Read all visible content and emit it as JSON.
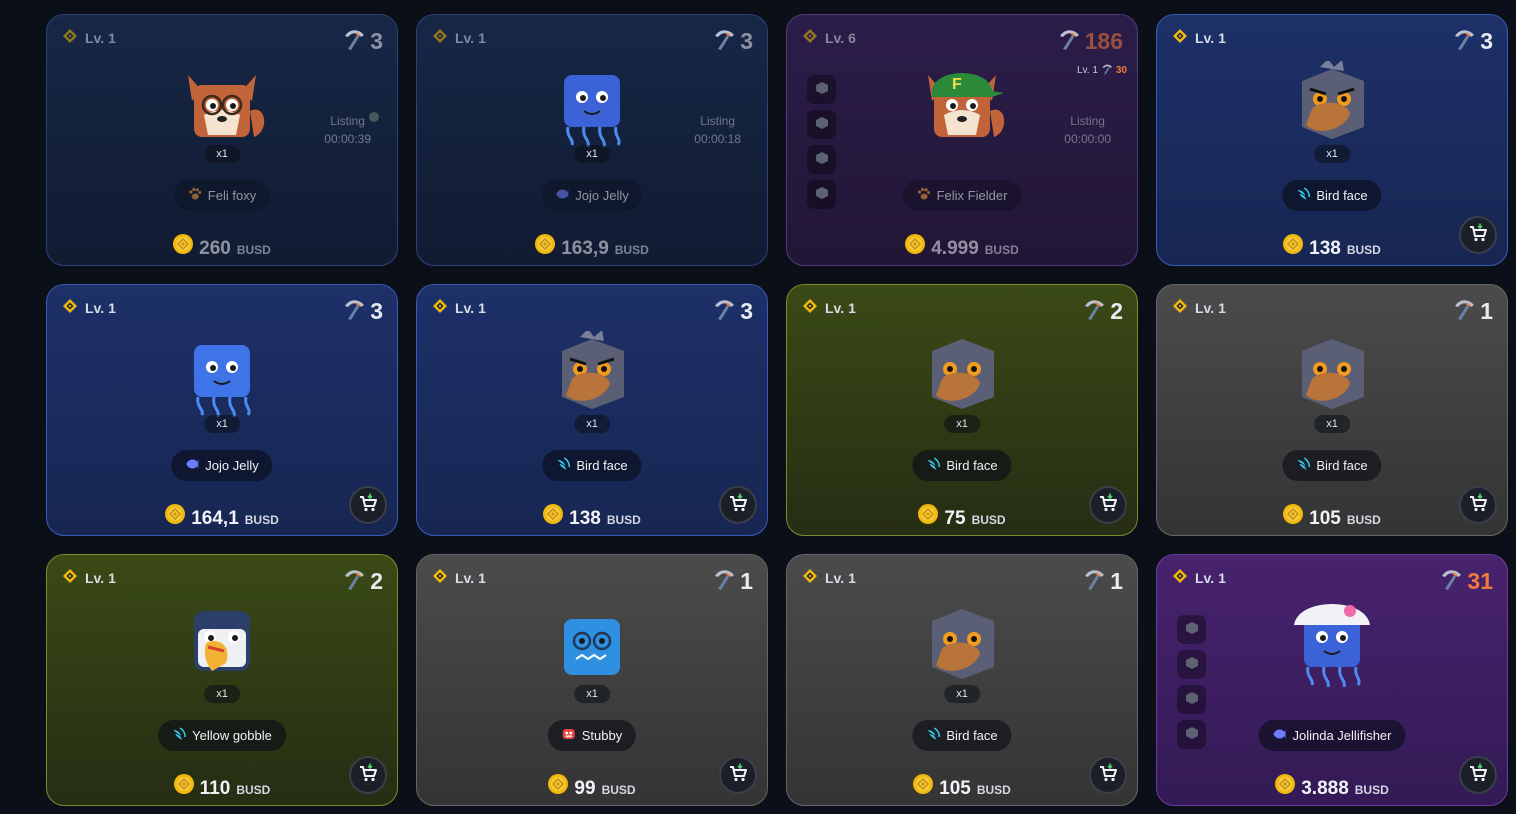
{
  "colors": {
    "busd_gold": "#f0b90b",
    "orange_accent": "#f07a3c",
    "listing_dot": "#6a8b6d"
  },
  "cards": [
    {
      "id": "c1",
      "theme": "t-navy",
      "dim": true,
      "level": "Lv. 1",
      "pickaxes": "3",
      "pick_orange": false,
      "sub_level": null,
      "multiplier": "x1",
      "listing_label": "Listing",
      "listing_timer": "00:00:39",
      "listing_dot": true,
      "name": "Feli foxy",
      "class_icon": "paw-icon",
      "class_color": "#f39b2f",
      "price": "260",
      "unit": "BUSD",
      "cart": false,
      "slots": false,
      "avatar": "fox-glasses",
      "avatar_color": "#c2643a"
    },
    {
      "id": "c2",
      "theme": "t-navy",
      "dim": true,
      "level": "Lv. 1",
      "pickaxes": "3",
      "pick_orange": false,
      "sub_level": null,
      "multiplier": "x1",
      "listing_label": "Listing",
      "listing_timer": "00:00:18",
      "listing_dot": false,
      "name": "Jojo Jelly",
      "class_icon": "fish-icon",
      "class_color": "#6e7cff",
      "price": "163,9",
      "unit": "BUSD",
      "cart": false,
      "slots": false,
      "avatar": "jelly",
      "avatar_color": "#3b62d6"
    },
    {
      "id": "c3",
      "theme": "t-purple",
      "dim": true,
      "level": "Lv. 6",
      "pickaxes": "186",
      "pick_orange": true,
      "sub_level": {
        "label": "Lv. 1",
        "count": "30"
      },
      "multiplier": null,
      "listing_label": "Listing",
      "listing_timer": "00:00:00",
      "listing_dot": false,
      "name": "Felix Fielder",
      "class_icon": "paw-icon",
      "class_color": "#f39b2f",
      "price": "4.999",
      "unit": "BUSD",
      "cart": false,
      "slots": true,
      "avatar": "fox-cap",
      "avatar_color": "#c2643a"
    },
    {
      "id": "c4",
      "theme": "t-blue",
      "dim": false,
      "level": "Lv. 1",
      "pickaxes": "3",
      "pick_orange": false,
      "sub_level": null,
      "multiplier": "x1",
      "listing_label": null,
      "listing_timer": null,
      "listing_dot": false,
      "name": "Bird face",
      "class_icon": "wing-icon",
      "class_color": "#35c7ef",
      "price": "138",
      "unit": "BUSD",
      "cart": true,
      "slots": false,
      "avatar": "bird-angry",
      "avatar_color": "#5b5f76"
    },
    {
      "id": "c5",
      "theme": "t-blue",
      "dim": false,
      "level": "Lv. 1",
      "pickaxes": "3",
      "pick_orange": false,
      "sub_level": null,
      "multiplier": "x1",
      "listing_label": null,
      "listing_timer": null,
      "listing_dot": false,
      "name": "Jojo Jelly",
      "class_icon": "fish-icon",
      "class_color": "#6e7cff",
      "price": "164,1",
      "unit": "BUSD",
      "cart": true,
      "slots": false,
      "avatar": "jelly",
      "avatar_color": "#3f74e8"
    },
    {
      "id": "c6",
      "theme": "t-blue",
      "dim": false,
      "level": "Lv. 1",
      "pickaxes": "3",
      "pick_orange": false,
      "sub_level": null,
      "multiplier": "x1",
      "listing_label": null,
      "listing_timer": null,
      "listing_dot": false,
      "name": "Bird face",
      "class_icon": "wing-icon",
      "class_color": "#35c7ef",
      "price": "138",
      "unit": "BUSD",
      "cart": true,
      "slots": false,
      "avatar": "bird-angry",
      "avatar_color": "#5b5f76"
    },
    {
      "id": "c7",
      "theme": "t-olive",
      "dim": false,
      "level": "Lv. 1",
      "pickaxes": "2",
      "pick_orange": false,
      "sub_level": null,
      "multiplier": "x1",
      "listing_label": null,
      "listing_timer": null,
      "listing_dot": false,
      "name": "Bird face",
      "class_icon": "wing-icon",
      "class_color": "#35c7ef",
      "price": "75",
      "unit": "BUSD",
      "cart": true,
      "slots": false,
      "avatar": "bird",
      "avatar_color": "#5b5f76"
    },
    {
      "id": "c8",
      "theme": "t-gray",
      "dim": false,
      "level": "Lv. 1",
      "pickaxes": "1",
      "pick_orange": false,
      "sub_level": null,
      "multiplier": "x1",
      "listing_label": null,
      "listing_timer": null,
      "listing_dot": false,
      "name": "Bird face",
      "class_icon": "wing-icon",
      "class_color": "#35c7ef",
      "price": "105",
      "unit": "BUSD",
      "cart": true,
      "slots": false,
      "avatar": "bird-plain",
      "avatar_color": "#5b5f76"
    },
    {
      "id": "c9",
      "theme": "t-olive",
      "dim": false,
      "level": "Lv. 1",
      "pickaxes": "2",
      "pick_orange": false,
      "sub_level": null,
      "multiplier": "x1",
      "listing_label": null,
      "listing_timer": null,
      "listing_dot": false,
      "name": "Yellow gobble",
      "class_icon": "wing-icon",
      "class_color": "#35c7ef",
      "price": "110",
      "unit": "BUSD",
      "cart": true,
      "slots": false,
      "avatar": "toucan",
      "avatar_color": "#2c3e6a"
    },
    {
      "id": "c10",
      "theme": "t-gray",
      "dim": false,
      "level": "Lv. 1",
      "pickaxes": "1",
      "pick_orange": false,
      "sub_level": null,
      "multiplier": "x1",
      "listing_label": null,
      "listing_timer": null,
      "listing_dot": false,
      "name": "Stubby",
      "class_icon": "monster-icon",
      "class_color": "#e8433f",
      "price": "99",
      "unit": "BUSD",
      "cart": true,
      "slots": false,
      "avatar": "blue-monster",
      "avatar_color": "#2f8fe0"
    },
    {
      "id": "c11",
      "theme": "t-gray",
      "dim": false,
      "level": "Lv. 1",
      "pickaxes": "1",
      "pick_orange": false,
      "sub_level": null,
      "multiplier": "x1",
      "listing_label": null,
      "listing_timer": null,
      "listing_dot": false,
      "name": "Bird face",
      "class_icon": "wing-icon",
      "class_color": "#35c7ef",
      "price": "105",
      "unit": "BUSD",
      "cart": true,
      "slots": false,
      "avatar": "bird-plain",
      "avatar_color": "#5b5f76"
    },
    {
      "id": "c12",
      "theme": "t-violet",
      "dim": false,
      "level": "Lv. 1",
      "pickaxes": "31",
      "pick_orange": true,
      "sub_level": null,
      "multiplier": null,
      "listing_label": null,
      "listing_timer": null,
      "listing_dot": false,
      "name": "Jolinda Jellifisher",
      "class_icon": "fish-icon",
      "class_color": "#6e7cff",
      "price": "3.888",
      "unit": "BUSD",
      "cart": true,
      "slots": true,
      "avatar": "jelly-hat",
      "avatar_color": "#3b62d6"
    }
  ]
}
